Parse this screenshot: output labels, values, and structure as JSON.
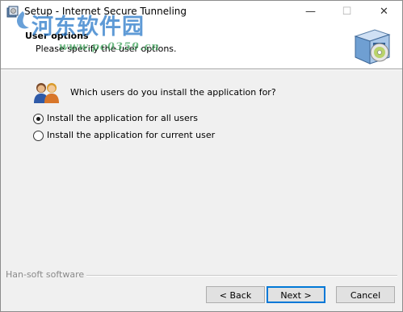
{
  "window": {
    "title": "Setup - Internet Secure Tunneling",
    "minimize_glyph": "—",
    "maximize_glyph": "☐",
    "close_glyph": "✕"
  },
  "header": {
    "title": "User options",
    "subtitle": "Please specify the user options.",
    "icon": "setup-box-cd-icon"
  },
  "watermark": {
    "line1": "河东软件园",
    "line2": "www.pc0359.cn"
  },
  "main": {
    "question": "Which users do you install the application for?",
    "icon": "users-icon",
    "options": [
      {
        "label": "Install the application for all users",
        "selected": true
      },
      {
        "label": "Install the application for current user",
        "selected": false
      }
    ]
  },
  "footer": {
    "brand": "Han-soft software",
    "back_label": "< Back",
    "next_label": "Next >",
    "cancel_label": "Cancel"
  },
  "colors": {
    "focus_border": "#0078d7",
    "dialog_bg": "#f0f0f0",
    "header_bg": "#ffffff"
  }
}
